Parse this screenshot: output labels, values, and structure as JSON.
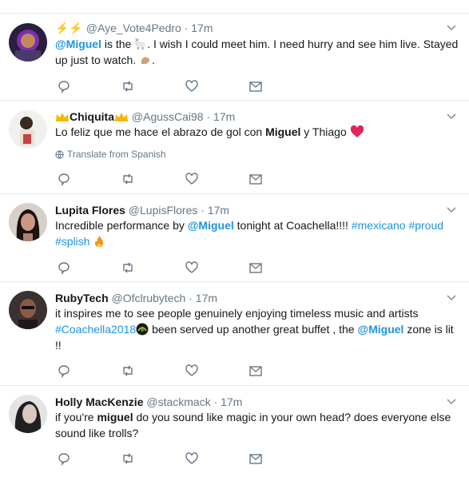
{
  "tweets": [
    {
      "name": "⚡⚡",
      "handle": "@Aye_Vote4Pedro",
      "dot": "·",
      "time": "17m",
      "text": {
        "mention": "@Miguel",
        "t1": " is the ",
        "t2": ". I wish I could meet him. I need hurry and see him live. Stayed up just to watch. ",
        "t3": "."
      }
    },
    {
      "name": "Chiquita",
      "handle": "@AgussCai98",
      "dot": "·",
      "time": "17m",
      "text": {
        "t1": "Lo feliz que me hace el abrazo de gol con ",
        "bold": "Miguel",
        "t2": " y Thiago "
      },
      "translate": "Translate from Spanish"
    },
    {
      "name": "Lupita Flores",
      "handle": "@LupisFlores",
      "dot": "·",
      "time": "17m",
      "text": {
        "t1": "Incredible performance by ",
        "mention": "@Miguel",
        "t2": " tonight at Coachella!!!! ",
        "h1": "#mexicano",
        "h2": "#proud",
        "h3": "#splish"
      }
    },
    {
      "name": "RubyTech",
      "handle": "@Ofclrubytech",
      "dot": "·",
      "time": "17m",
      "text": {
        "line1": "it inspires me to see people genuinely enjoying timeless music and artists",
        "h1": "#Coachella2018",
        "t2": " been served up another great buffet , the ",
        "mention": "@Miguel",
        "t3": " zone is lit",
        "line3": "!!"
      }
    },
    {
      "name": "Holly MacKenzie",
      "handle": "@stackmack",
      "dot": "·",
      "time": "17m",
      "text": {
        "t1": "if you're ",
        "bold": "miguel",
        "t2": " do you sound like magic in your own head? does everyone else sound like trolls?"
      }
    }
  ],
  "icons": {
    "reply": "reply-icon",
    "retweet": "retweet-icon",
    "like": "heart-icon",
    "dm": "envelope-icon",
    "caret": "chevron-down-icon",
    "globe": "globe-icon"
  },
  "colors": {
    "link": "#1c94e0",
    "secondary": "#657786",
    "icon": "#657786",
    "divider": "#e6ecf0",
    "heart_emoji": "#e0245e",
    "crown": "#f5b800"
  }
}
